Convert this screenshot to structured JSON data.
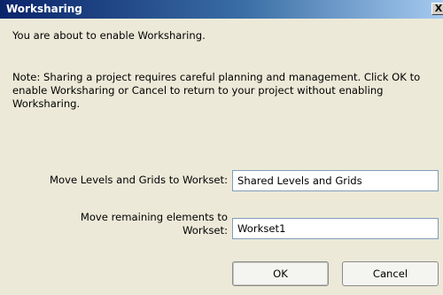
{
  "window": {
    "title": "Worksharing",
    "close_glyph": "X"
  },
  "body": {
    "intro": "You are about to enable Worksharing.",
    "note": "Note: Sharing a project requires careful planning and management.  Click OK to enable Worksharing or Cancel to return to your project without enabling Worksharing."
  },
  "fields": {
    "levels_label": "Move Levels and Grids to Workset:",
    "levels_value": "Shared Levels and Grids",
    "remaining_label": "Move remaining elements to Workset:",
    "remaining_value": "Workset1"
  },
  "buttons": {
    "ok": "OK",
    "cancel": "Cancel"
  },
  "icons": {
    "close": "close-icon"
  },
  "colors": {
    "title_bar_start": "#0a246a",
    "title_bar_end": "#a6caf0",
    "dialog_background": "#ece9d8",
    "input_border": "#7f9db9"
  }
}
